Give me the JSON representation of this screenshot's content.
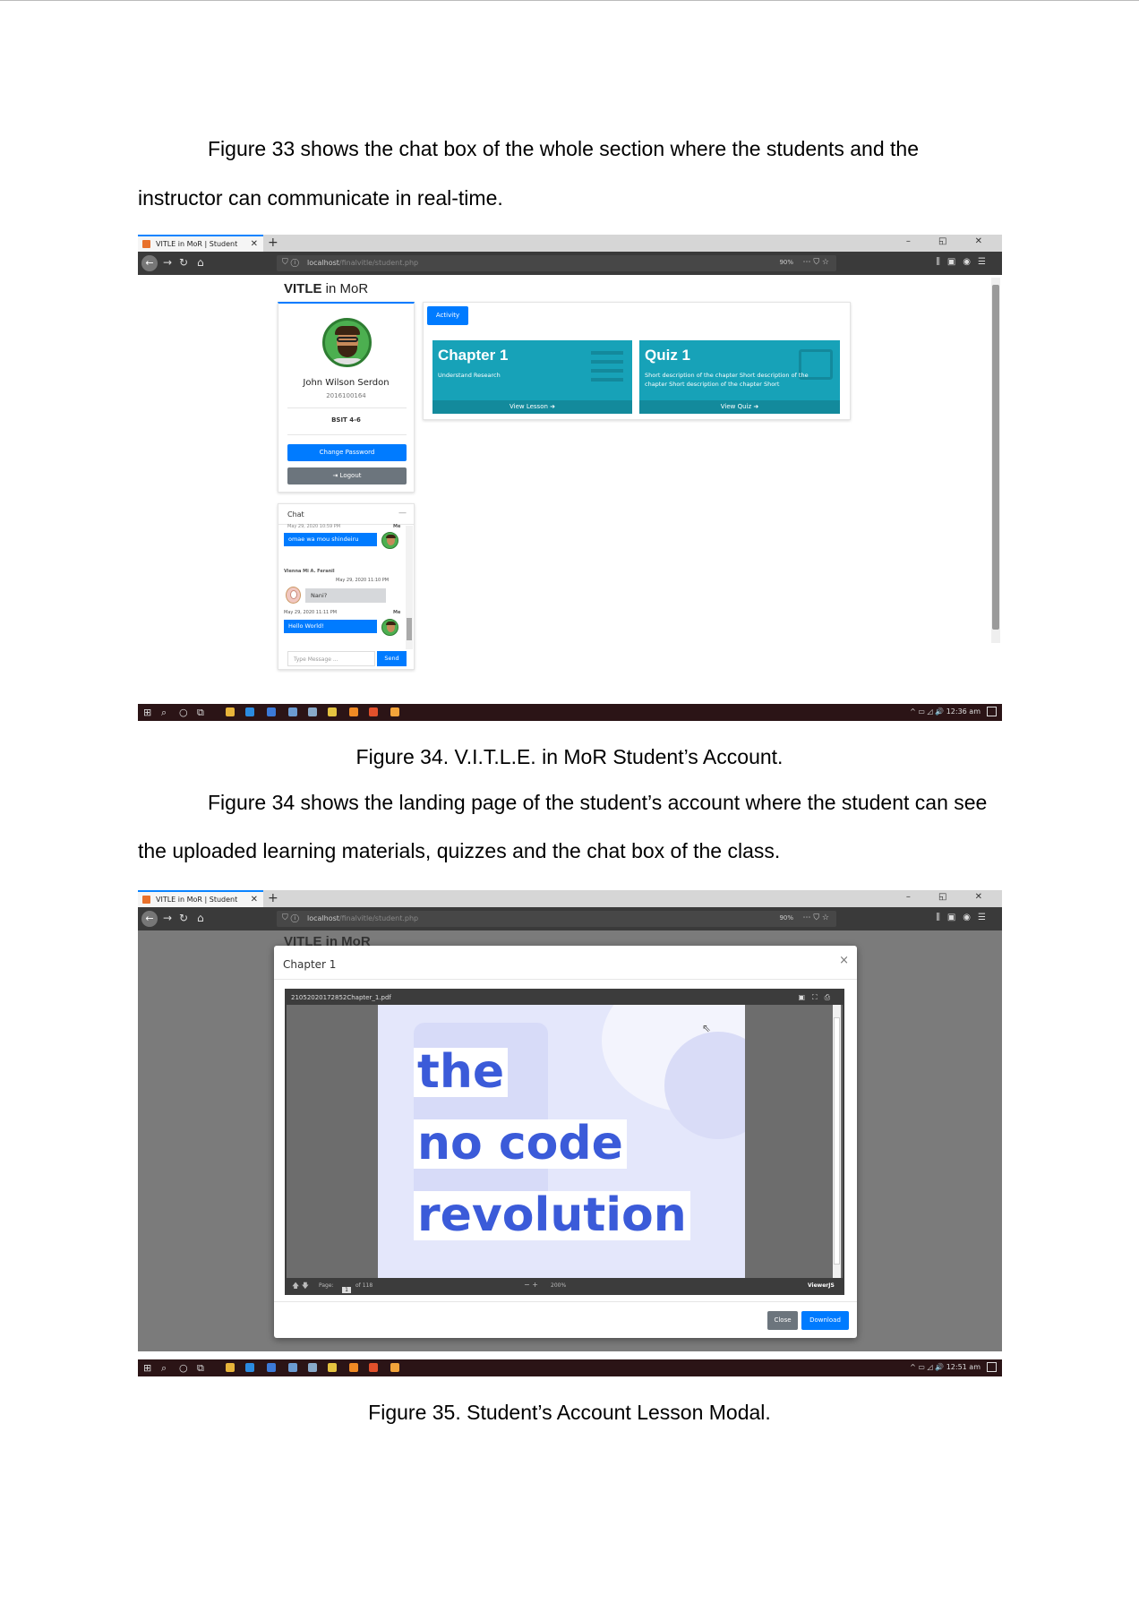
{
  "paragraphs": {
    "p1_line1": "Figure 33 shows the chat box of the whole section where the students and  the",
    "p1_line2": "instructor can communicate in real-time.",
    "p2_line1": "Figure 34 shows the landing page of the student’s account where the student can see",
    "p2_line2": "the uploaded learning materials, quizzes and the chat box of the class."
  },
  "captions": {
    "fig34": "Figure 34. V.I.T.L.E. in MoR Student’s Account.",
    "fig35": "Figure 35. Student’s Account Lesson Modal."
  },
  "browser": {
    "tab_title": "VITLE in MoR | Student",
    "url_host": "localhost",
    "url_path": "/finalvitle/student.php",
    "zoom": "90%",
    "new_tab": "+",
    "window_controls": "– ◱ ✕"
  },
  "taskbar": {
    "clock_fig34": "12:36 am",
    "clock_fig35": "12:51 am"
  },
  "fig34": {
    "brand_bold": "VITLE",
    "brand_rest": " in MoR",
    "profile": {
      "name": "John Wilson Serdon",
      "student_id": "2016100164",
      "section": "BSIT 4-6",
      "change_password": "Change Password",
      "logout": "⇥ Logout"
    },
    "chat": {
      "title": "Chat",
      "minimize": "—",
      "top_meta": "May 29, 2020 10:59 PM",
      "top_me": "Me",
      "msg1": "omae wa mou shindeiru",
      "sender2": "Vienna Mi A. Feranil",
      "time2": "May 29, 2020 11:10 PM",
      "msg2": "Nani?",
      "time3": "May 29, 2020 11:11 PM",
      "me3": "Me",
      "msg3": "Hello World!",
      "input_placeholder": "Type Message ...",
      "send": "Send"
    },
    "activity_tab": "Activity",
    "cards": [
      {
        "title": "Chapter 1",
        "desc": "Understand Research",
        "footer": "View Lesson ➜"
      },
      {
        "title": "Quiz 1",
        "desc": "Short description of the chapter Short description of the chapter Short description of the chapter Short",
        "footer": "View Quiz ➜"
      }
    ]
  },
  "fig35": {
    "bg_brand": "VITLE in MoR",
    "modal_title": "Chapter 1",
    "modal_close_x": "×",
    "pdf_filename": "21052020172852Chapter_1.pdf",
    "page_label": "Page:",
    "page_value": "1",
    "page_total": "of 118",
    "zoom_value": "200%",
    "viewer_brand": "ViewerJS",
    "slide_words": [
      "the",
      "no code",
      "revolution"
    ],
    "close_button": "Close",
    "download_button": "Download"
  },
  "colors": {
    "primary": "#007bff",
    "card_teal": "#17a2b8",
    "secondary": "#6c757d",
    "taskbar": "#2b1416",
    "slide_text": "#3b5bd9"
  }
}
